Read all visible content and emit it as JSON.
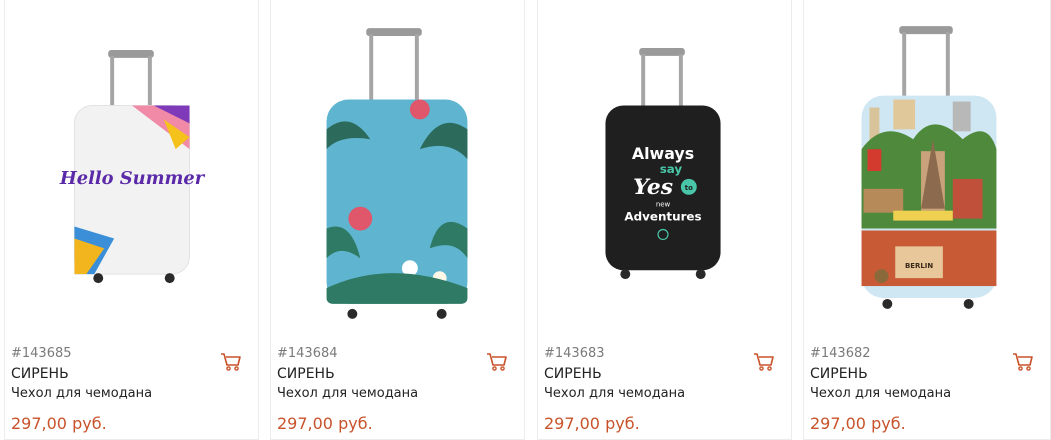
{
  "colors": {
    "price": "#c8532a",
    "cart_icon": "#c8532a",
    "sku": "#7a7a7a"
  },
  "products": [
    {
      "sku": "#143685",
      "brand": "СИРЕНЬ",
      "title": "Чехол для чемодана",
      "price": "297,00 руб.",
      "cover_text": "Hello Summer",
      "image": "suitcase-hello-summer"
    },
    {
      "sku": "#143684",
      "brand": "СИРЕНЬ",
      "title": "Чехол для чемодана",
      "price": "297,00 руб.",
      "image": "suitcase-tropical-flowers"
    },
    {
      "sku": "#143683",
      "brand": "СИРЕНЬ",
      "title": "Чехол для чемодана",
      "price": "297,00 руб.",
      "cover_text": [
        "Always",
        "say",
        "Yes",
        "to",
        "new",
        "Adventures"
      ],
      "image": "suitcase-always-say-yes"
    },
    {
      "sku": "#143682",
      "brand": "СИРЕНЬ",
      "title": "Чехол для чемодана",
      "price": "297,00 руб.",
      "cover_text": "BERLIN",
      "image": "suitcase-travel-collage"
    }
  ]
}
